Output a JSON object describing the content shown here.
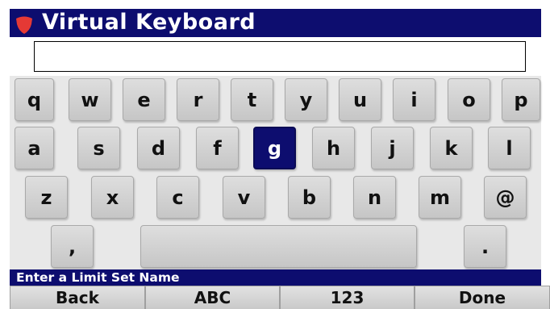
{
  "app": {
    "title": "Virtual Keyboard",
    "logo_icon": "shield-logo",
    "accent_color": "#0d0d6f",
    "logo_color": "#e53935"
  },
  "input": {
    "value": "",
    "placeholder": ""
  },
  "keyboard": {
    "selected_key": "g",
    "rows": [
      [
        "q",
        "w",
        "e",
        "r",
        "t",
        "y",
        "u",
        "i",
        "o",
        "p"
      ],
      [
        "a",
        "s",
        "d",
        "f",
        "g",
        "h",
        "j",
        "k",
        "l"
      ],
      [
        "z",
        "x",
        "c",
        "v",
        "b",
        "n",
        "m",
        "@"
      ],
      [
        ",",
        "",
        "."
      ]
    ],
    "space_label": ""
  },
  "status": {
    "text": "Enter a Limit Set Name"
  },
  "softkeys": [
    "Back",
    "ABC",
    "123",
    "Done"
  ]
}
